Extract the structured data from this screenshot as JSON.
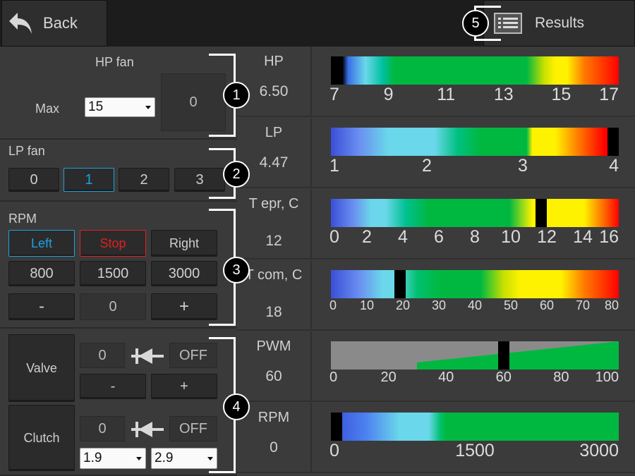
{
  "header": {
    "back_label": "Back",
    "results_label": "Results",
    "results_badge": "5"
  },
  "hp_fan": {
    "title": "HP fan",
    "max_label": "Max",
    "max_value": "15",
    "display": "0",
    "badge": "1"
  },
  "lp_fan": {
    "title": "LP fan",
    "options": [
      "0",
      "1",
      "2",
      "3"
    ],
    "selected": "1",
    "badge": "2"
  },
  "rpm": {
    "title": "RPM",
    "left": "Left",
    "stop": "Stop",
    "right": "Right",
    "presets": [
      "800",
      "1500",
      "3000"
    ],
    "minus": "-",
    "value": "0",
    "plus": "+",
    "badge": "3"
  },
  "valve": {
    "label": "Valve",
    "value": "0",
    "state": "OFF",
    "minus": "-",
    "plus": "+"
  },
  "clutch": {
    "label": "Clutch",
    "value": "0",
    "state": "OFF",
    "sel1": "1.9",
    "sel2": "2.9",
    "badge": "4"
  },
  "gauges": [
    {
      "label": "HP",
      "value": "6.50",
      "ticks": [
        "7",
        "9",
        "11",
        "13",
        "15",
        "17"
      ],
      "marker": 0.01
    },
    {
      "label": "LP",
      "value": "4.47",
      "ticks": [
        "1",
        "2",
        "3",
        "4"
      ],
      "marker": 0.98
    },
    {
      "label": "T epr, C",
      "value": "12",
      "ticks": [
        "0",
        "2",
        "4",
        "6",
        "8",
        "10",
        "12",
        "14",
        "16"
      ],
      "marker": 0.73
    },
    {
      "label": "T com, C",
      "value": "18",
      "ticks": [
        "0",
        "10",
        "20",
        "30",
        "40",
        "50",
        "60",
        "70",
        "80"
      ],
      "marker": 0.24
    },
    {
      "label": "PWM",
      "value": "60",
      "ticks": [
        "0",
        "20",
        "40",
        "60",
        "80",
        "100"
      ],
      "marker": 0.6
    },
    {
      "label": "RPM",
      "value": "0",
      "ticks": [
        "0",
        "1500",
        "3000"
      ],
      "marker": 0.01
    }
  ],
  "colors": {
    "blue": "#3a4fd8",
    "cyan": "#6ad8ea",
    "green": "#00b840",
    "yellow": "#fff200",
    "red": "#ff0000",
    "orange": "#ff7a00",
    "highlight_blue": "#1aa3e0",
    "stop_red": "#e02020"
  }
}
